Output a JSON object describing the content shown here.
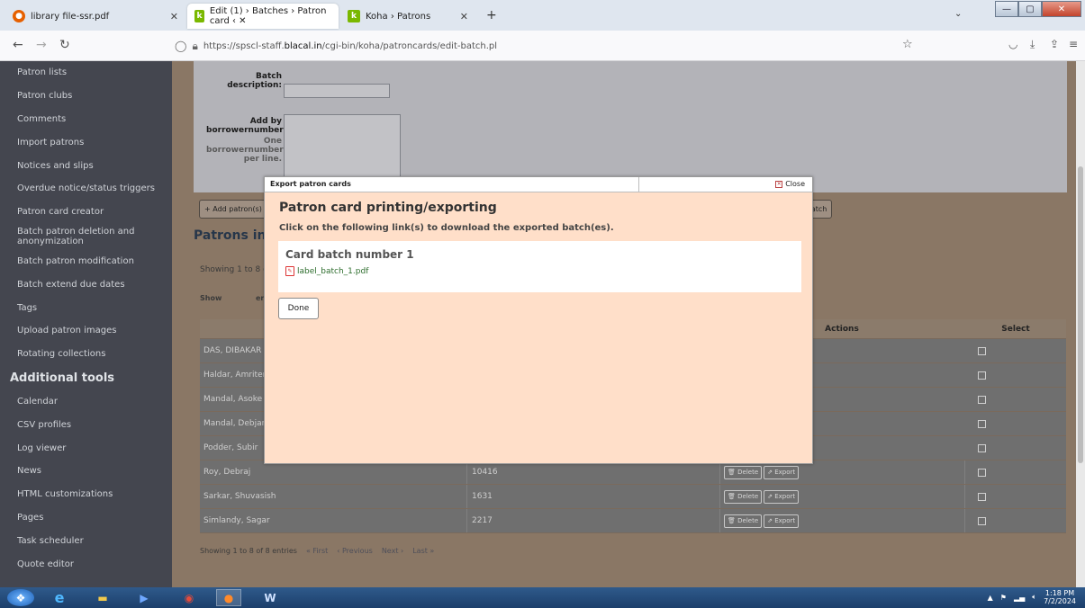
{
  "browser": {
    "tabs": [
      {
        "label": "library file-ssr.pdf"
      },
      {
        "label": "Edit (1) › Batches › Patron card ‹ ✕"
      },
      {
        "label": "Koha › Patrons"
      }
    ],
    "url_prefix": "https://spscl-staff.",
    "url_host": "blacal.in",
    "url_path": "/cgi-bin/koha/patroncards/edit-batch.pl"
  },
  "sidebar": {
    "items_top": [
      "Patron lists",
      "Patron clubs",
      "Comments",
      "Import patrons",
      "Notices and slips",
      "Overdue notice/status triggers",
      "Patron card creator",
      "Batch patron deletion and anonymization",
      "Batch patron modification",
      "Batch extend due dates",
      "Tags",
      "Upload patron images",
      "Rotating collections"
    ],
    "section_title": "Additional tools",
    "items_bottom": [
      "Calendar",
      "CSV profiles",
      "Log viewer",
      "News",
      "HTML customizations",
      "Pages",
      "Task scheduler",
      "Quote editor"
    ]
  },
  "form": {
    "batch_description_label": "Batch description:",
    "add_by_label": "Add by borrowernumber(",
    "one_per_line_label": "One borrowernumber per line.",
    "add_patrons_button": "+ Add patron(s)",
    "right_button": "rd batch"
  },
  "patrons": {
    "section_title": "Patrons in b",
    "showing_top": "Showing 1 to 8 o",
    "show_label": "Show",
    "entries_label": "ent",
    "col_actions": "Actions",
    "col_select": "Select",
    "rows": [
      {
        "name": "DAS, DIBAKAR",
        "number": ""
      },
      {
        "name": "Haldar, Amriten",
        "number": ""
      },
      {
        "name": "Mandal, Asoke",
        "number": ""
      },
      {
        "name": "Mandal, Debjan",
        "number": ""
      },
      {
        "name": "Podder, Subir",
        "number": ""
      },
      {
        "name": "Roy, Debraj",
        "number": "10416"
      },
      {
        "name": "Sarkar, Shuvasish",
        "number": "1631"
      },
      {
        "name": "Simlandy, Sagar",
        "number": "2217"
      }
    ],
    "delete_label": "Delete",
    "export_label": "Export",
    "showing_bottom": "Showing 1 to 8 of 8 entries",
    "pager": [
      "« First",
      "‹ Previous",
      "Next ›",
      "Last »"
    ]
  },
  "modal": {
    "title": "Export patron cards",
    "close_label": "Close",
    "heading": "Patron card printing/exporting",
    "instruction": "Click on the following link(s) to download the exported batch(es).",
    "batch_heading": "Card batch number 1",
    "file_link": "label_batch_1.pdf",
    "done_label": "Done"
  },
  "taskbar": {
    "time": "1:18 PM",
    "date": "7/2/2024"
  }
}
